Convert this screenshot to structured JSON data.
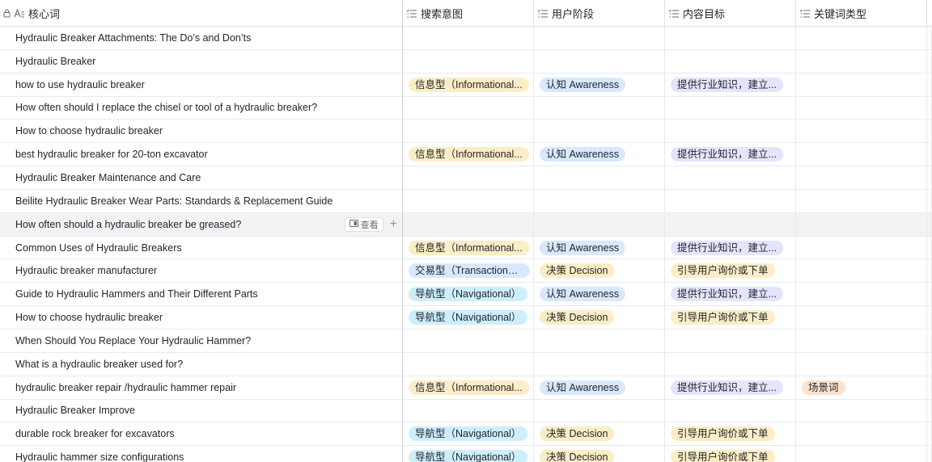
{
  "columns": [
    {
      "label": "核心词",
      "icon": "text-icon"
    },
    {
      "label": "搜索意图",
      "icon": "list-icon"
    },
    {
      "label": "用户阶段",
      "icon": "list-icon"
    },
    {
      "label": "内容目标",
      "icon": "list-icon"
    },
    {
      "label": "关键词类型",
      "icon": "list-icon"
    }
  ],
  "row_actions": {
    "view_label": "查看",
    "add_label": "+"
  },
  "colors": {
    "yellow": "#fbedc6",
    "blue": "#dae8fd",
    "cyan": "#cdeffb",
    "purple": "#e3e5fb",
    "orange": "#fde2cf"
  },
  "rows": [
    {
      "keyword": "Hydraulic Breaker Attachments: The Do’s and Don’ts",
      "intent": "",
      "stage": "",
      "goal": "",
      "type": ""
    },
    {
      "keyword": "Hydraulic Breaker",
      "intent": "",
      "stage": "",
      "goal": "",
      "type": ""
    },
    {
      "keyword": "how to use hydraulic breaker",
      "intent": "信息型（Informational...",
      "intent_color": "yellow",
      "stage": "认知 Awareness",
      "stage_color": "blue",
      "goal": "提供行业知识，建立...",
      "goal_color": "purple",
      "type": ""
    },
    {
      "keyword": "How often should I replace the chisel or tool of a hydraulic breaker?",
      "intent": "",
      "stage": "",
      "goal": "",
      "type": ""
    },
    {
      "keyword": "How to choose hydraulic breaker",
      "intent": "",
      "stage": "",
      "goal": "",
      "type": ""
    },
    {
      "keyword": "best hydraulic breaker for 20-ton excavator",
      "intent": "信息型（Informational...",
      "intent_color": "yellow",
      "stage": "认知 Awareness",
      "stage_color": "blue",
      "goal": "提供行业知识，建立...",
      "goal_color": "purple",
      "type": ""
    },
    {
      "keyword": "Hydraulic Breaker Maintenance and Care",
      "intent": "",
      "stage": "",
      "goal": "",
      "type": ""
    },
    {
      "keyword": "Beilite Hydraulic Breaker Wear Parts: Standards & Replacement Guide",
      "intent": "",
      "stage": "",
      "goal": "",
      "type": ""
    },
    {
      "keyword": "How often should a hydraulic breaker be greased?",
      "intent": "",
      "stage": "",
      "goal": "",
      "type": "",
      "hover": true
    },
    {
      "keyword": "Common Uses of Hydraulic Breakers",
      "intent": "信息型（Informational...",
      "intent_color": "yellow",
      "stage": "认知 Awareness",
      "stage_color": "blue",
      "goal": "提供行业知识，建立...",
      "goal_color": "purple",
      "type": ""
    },
    {
      "keyword": "Hydraulic breaker manufacturer",
      "intent": "交易型（Transactional）",
      "intent_color": "blue",
      "stage": "决策 Decision",
      "stage_color": "yellow",
      "goal": "引导用户询价或下单",
      "goal_color": "yellow",
      "type": ""
    },
    {
      "keyword": "Guide to Hydraulic Hammers and Their Different Parts",
      "intent": "导航型（Navigational）",
      "intent_color": "cyan",
      "stage": "认知 Awareness",
      "stage_color": "blue",
      "goal": "提供行业知识，建立...",
      "goal_color": "purple",
      "type": ""
    },
    {
      "keyword": "How to choose hydraulic breaker",
      "intent": "导航型（Navigational）",
      "intent_color": "cyan",
      "stage": "决策 Decision",
      "stage_color": "yellow",
      "goal": "引导用户询价或下单",
      "goal_color": "yellow",
      "type": ""
    },
    {
      "keyword": "When Should You Replace Your Hydraulic Hammer?",
      "intent": "",
      "stage": "",
      "goal": "",
      "type": ""
    },
    {
      "keyword": "What is a hydraulic breaker used for?",
      "intent": "",
      "stage": "",
      "goal": "",
      "type": ""
    },
    {
      "keyword": "hydraulic breaker repair /hydraulic hammer repair",
      "intent": "信息型（Informational...",
      "intent_color": "yellow",
      "stage": "认知 Awareness",
      "stage_color": "blue",
      "goal": "提供行业知识，建立...",
      "goal_color": "purple",
      "type": "场景词",
      "type_color": "orange"
    },
    {
      "keyword": "Hydraulic Breaker Improve",
      "intent": "",
      "stage": "",
      "goal": "",
      "type": ""
    },
    {
      "keyword": "durable rock breaker for excavators",
      "intent": "导航型（Navigational）",
      "intent_color": "cyan",
      "stage": "决策 Decision",
      "stage_color": "yellow",
      "goal": "引导用户询价或下单",
      "goal_color": "yellow",
      "type": ""
    },
    {
      "keyword": "Hydraulic hammer size configurations",
      "intent": "导航型（Navigational）",
      "intent_color": "cyan",
      "stage": "决策 Decision",
      "stage_color": "yellow",
      "goal": "引导用户询价或下单",
      "goal_color": "yellow",
      "type": ""
    }
  ]
}
